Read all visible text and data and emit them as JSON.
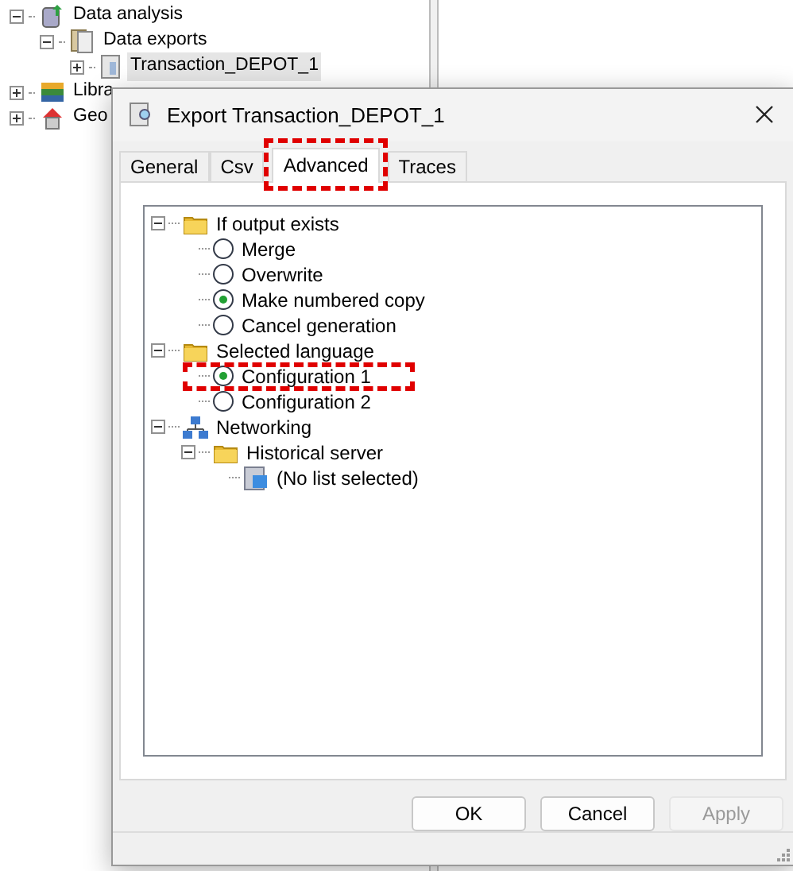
{
  "background_tree": [
    {
      "label": "Data analysis",
      "kind": "analysis",
      "expanded": true,
      "selected": false,
      "children": [
        {
          "label": "Data exports",
          "kind": "exports",
          "expanded": true,
          "selected": false,
          "children": [
            {
              "label": "Transaction_DEPOT_1",
              "kind": "export",
              "selected": true
            }
          ]
        }
      ]
    },
    {
      "label": "Libra",
      "kind": "library",
      "selected": false
    },
    {
      "label": "Geo",
      "kind": "geography",
      "selected": false
    }
  ],
  "dialog": {
    "title": "Export Transaction_DEPOT_1",
    "tabs": [
      {
        "label": "General",
        "selected": false,
        "highlighted": false
      },
      {
        "label": "Csv",
        "selected": false,
        "highlighted": false
      },
      {
        "label": "Advanced",
        "selected": true,
        "highlighted": true
      },
      {
        "label": "Traces",
        "selected": false,
        "highlighted": false
      }
    ],
    "tree": [
      {
        "label": "If output exists",
        "kind": "folder",
        "expanded": true,
        "children": [
          {
            "label": "Merge",
            "kind": "radio",
            "selected": false,
            "highlighted": false
          },
          {
            "label": "Overwrite",
            "kind": "radio",
            "selected": false,
            "highlighted": false
          },
          {
            "label": "Make numbered copy",
            "kind": "radio",
            "selected": true,
            "highlighted": false
          },
          {
            "label": "Cancel generation",
            "kind": "radio",
            "selected": false,
            "highlighted": false
          }
        ]
      },
      {
        "label": "Selected language",
        "kind": "folder",
        "expanded": true,
        "children": [
          {
            "label": "Configuration 1",
            "kind": "radio",
            "selected": true,
            "highlighted": true
          },
          {
            "label": "Configuration 2",
            "kind": "radio",
            "selected": false,
            "highlighted": false
          }
        ]
      },
      {
        "label": "Networking",
        "kind": "network",
        "expanded": true,
        "children": [
          {
            "label": "Historical server",
            "kind": "folder",
            "expanded": true,
            "children": [
              {
                "label": "(No list selected)",
                "kind": "list"
              }
            ]
          }
        ]
      }
    ],
    "buttons": [
      {
        "label": "OK",
        "disabled": false
      },
      {
        "label": "Cancel",
        "disabled": false
      },
      {
        "label": "Apply",
        "disabled": true
      }
    ]
  }
}
